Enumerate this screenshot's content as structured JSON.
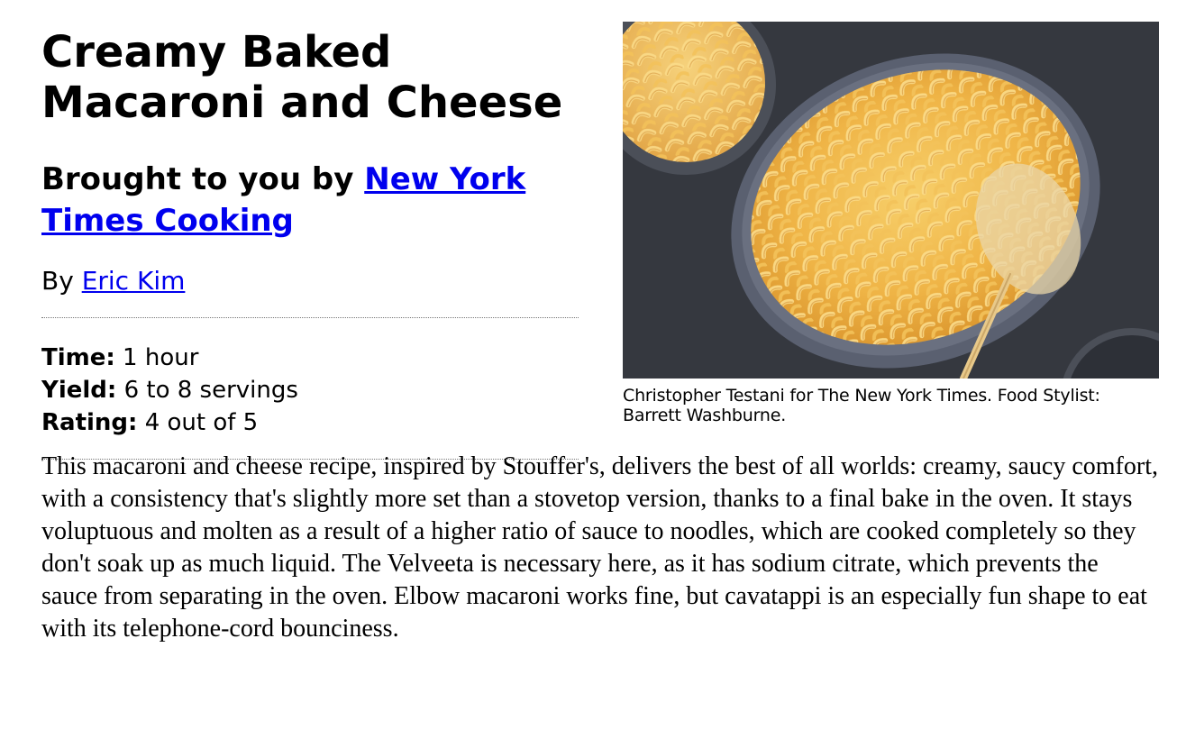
{
  "recipe": {
    "title": "Creamy Baked Macaroni and Cheese",
    "brought_prefix": "Brought to you by ",
    "brought_link": "New York Times Cooking",
    "by_prefix": "By ",
    "author": "Eric Kim",
    "time_label": "Time:",
    "time_value": "1 hour",
    "yield_label": "Yield:",
    "yield_value": "6 to 8 servings",
    "rating_label": "Rating:",
    "rating_value": "4 out of 5",
    "description": "This macaroni and cheese recipe, inspired by Stouffer's, delivers the best of all worlds: creamy, saucy comfort, with a consistency that's slightly more set than a stovetop version, thanks to a final bake in the oven. It stays voluptuous and molten as a result of a higher ratio of sauce to noodles, which are cooked completely so they don't soak up as much liquid. The Velveeta is necessary here, as it has sodium citrate, which prevents the sauce from separating in the oven. Elbow macaroni works fine, but cavatappi is an especially fun shape to eat with its telephone-cord bounciness."
  },
  "photo": {
    "caption": "Christopher Testani for The New York Times. Food Stylist: Barrett Washburne."
  },
  "colors": {
    "link": "#0000ee",
    "background": "#ffffff",
    "surface": "#3a3d44",
    "cheese": "#f0b845"
  }
}
